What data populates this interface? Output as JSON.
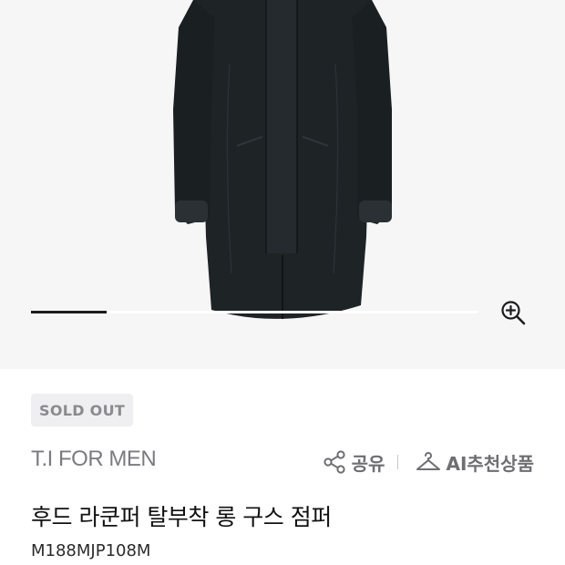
{
  "product": {
    "status_badge": "SOLD OUT",
    "brand": "T.I FOR MEN",
    "title": "후드 라쿤퍼 탈부착 롱 구스 점퍼",
    "code": "M188MJP108M"
  },
  "gallery": {
    "progress_fraction": 0.17,
    "zoom_icon": "zoom-in-icon"
  },
  "actions": {
    "share_label": "공유",
    "share_icon": "share-icon",
    "ai_recommend_label": "AI추천상품",
    "ai_recommend_icon": "hanger-icon"
  },
  "colors": {
    "hero_background": "#f6f6f7",
    "badge_background": "#efeff1",
    "coat": "#1e2326"
  }
}
